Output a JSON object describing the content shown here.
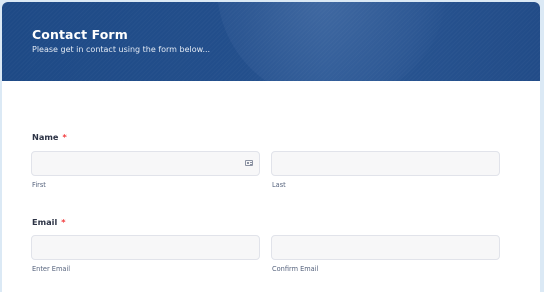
{
  "form": {
    "title": "Contact Form",
    "subtitle": "Please get in contact using the form below..."
  },
  "name_field": {
    "label": "Name",
    "required_mark": "*",
    "first": {
      "value": "",
      "sublabel": "First",
      "icon": "contact-card-icon"
    },
    "last": {
      "value": "",
      "sublabel": "Last"
    }
  },
  "email_field": {
    "label": "Email",
    "required_mark": "*",
    "enter": {
      "value": "",
      "sublabel": "Enter Email"
    },
    "confirm": {
      "value": "",
      "sublabel": "Confirm Email"
    }
  },
  "colors": {
    "header_bg": "#1e4a86",
    "required": "#f23a3c",
    "page_bg": "#dbe9f5"
  }
}
